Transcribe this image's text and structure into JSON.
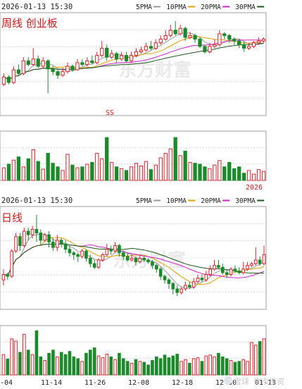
{
  "colors": {
    "up": "#e0202a",
    "down": "#1a8a2a",
    "ma5": "#9a9a9a",
    "ma10": "#e0a000",
    "ma20": "#d020d0",
    "ma30": "#1a5a1a",
    "grid": "#c8c8c8",
    "axis": "#888888",
    "text": "#222222",
    "chart_title": "#d01818",
    "watermark": "#e6e6e6"
  },
  "weekly": {
    "datetime": "2026-01-13 15:30",
    "legend": [
      {
        "label": "5PMA",
        "color_key": "ma5"
      },
      {
        "label": "10PMA",
        "color_key": "ma10"
      },
      {
        "label": "20PMA",
        "color_key": "ma20"
      },
      {
        "label": "30PMA",
        "color_key": "ma30"
      }
    ],
    "title": "周线 创业板",
    "marker": "SS",
    "year_label": "2026"
  },
  "daily": {
    "datetime": "2026-01-13 15:30",
    "legend": [
      {
        "label": "5PMA",
        "color_key": "ma5"
      },
      {
        "label": "10PMA",
        "color_key": "ma10"
      },
      {
        "label": "20PMA",
        "color_key": "ma20"
      },
      {
        "label": "30PMA",
        "color_key": "ma30"
      }
    ],
    "title": "日线",
    "date_labels": [
      "-04",
      "11-14",
      "11-26",
      "12-08",
      "12-18",
      "12-30",
      "01-13"
    ]
  },
  "watermark": {
    "top": "东方财富",
    "bottom_left": "雪球",
    "bottom_right": "牛市投资"
  },
  "chart_data": [
    {
      "type": "candlestick",
      "title": "周线 创业板",
      "period": "weekly",
      "price_range": [
        0,
        100
      ],
      "volume_range": [
        0,
        100
      ],
      "candles": [
        {
          "o": 30,
          "c": 38,
          "h": 42,
          "l": 28,
          "v": 28
        },
        {
          "o": 38,
          "c": 32,
          "h": 40,
          "l": 30,
          "v": 36
        },
        {
          "o": 32,
          "c": 46,
          "h": 50,
          "l": 30,
          "v": 45
        },
        {
          "o": 46,
          "c": 42,
          "h": 52,
          "l": 40,
          "v": 52
        },
        {
          "o": 42,
          "c": 56,
          "h": 60,
          "l": 40,
          "v": 30
        },
        {
          "o": 56,
          "c": 52,
          "h": 60,
          "l": 50,
          "v": 48
        },
        {
          "o": 52,
          "c": 58,
          "h": 70,
          "l": 50,
          "v": 68
        },
        {
          "o": 58,
          "c": 50,
          "h": 62,
          "l": 48,
          "v": 42
        },
        {
          "o": 50,
          "c": 56,
          "h": 60,
          "l": 48,
          "v": 25
        },
        {
          "o": 56,
          "c": 47,
          "h": 58,
          "l": 20,
          "v": 60
        },
        {
          "o": 47,
          "c": 44,
          "h": 50,
          "l": 40,
          "v": 38
        },
        {
          "o": 44,
          "c": 40,
          "h": 46,
          "l": 36,
          "v": 30
        },
        {
          "o": 40,
          "c": 44,
          "h": 48,
          "l": 38,
          "v": 22
        },
        {
          "o": 44,
          "c": 50,
          "h": 54,
          "l": 42,
          "v": 58
        },
        {
          "o": 50,
          "c": 46,
          "h": 52,
          "l": 44,
          "v": 34
        },
        {
          "o": 46,
          "c": 54,
          "h": 58,
          "l": 45,
          "v": 28
        },
        {
          "o": 54,
          "c": 52,
          "h": 58,
          "l": 50,
          "v": 30
        },
        {
          "o": 52,
          "c": 56,
          "h": 60,
          "l": 50,
          "v": 36
        },
        {
          "o": 56,
          "c": 54,
          "h": 62,
          "l": 52,
          "v": 40
        },
        {
          "o": 54,
          "c": 62,
          "h": 66,
          "l": 52,
          "v": 60
        },
        {
          "o": 62,
          "c": 70,
          "h": 78,
          "l": 60,
          "v": 48
        },
        {
          "o": 70,
          "c": 60,
          "h": 74,
          "l": 56,
          "v": 95
        },
        {
          "o": 60,
          "c": 64,
          "h": 68,
          "l": 58,
          "v": 40
        },
        {
          "o": 64,
          "c": 58,
          "h": 66,
          "l": 54,
          "v": 30
        },
        {
          "o": 58,
          "c": 62,
          "h": 66,
          "l": 56,
          "v": 26
        },
        {
          "o": 62,
          "c": 56,
          "h": 66,
          "l": 54,
          "v": 22
        },
        {
          "o": 56,
          "c": 62,
          "h": 66,
          "l": 54,
          "v": 30
        },
        {
          "o": 62,
          "c": 66,
          "h": 70,
          "l": 60,
          "v": 38
        },
        {
          "o": 66,
          "c": 68,
          "h": 72,
          "l": 64,
          "v": 32
        },
        {
          "o": 68,
          "c": 72,
          "h": 76,
          "l": 66,
          "v": 42
        },
        {
          "o": 72,
          "c": 70,
          "h": 78,
          "l": 68,
          "v": 24
        },
        {
          "o": 70,
          "c": 76,
          "h": 80,
          "l": 68,
          "v": 34
        },
        {
          "o": 76,
          "c": 80,
          "h": 84,
          "l": 74,
          "v": 50
        },
        {
          "o": 80,
          "c": 84,
          "h": 90,
          "l": 78,
          "v": 60
        },
        {
          "o": 84,
          "c": 90,
          "h": 96,
          "l": 82,
          "v": 70
        },
        {
          "o": 90,
          "c": 86,
          "h": 100,
          "l": 84,
          "v": 95
        },
        {
          "o": 86,
          "c": 92,
          "h": 96,
          "l": 84,
          "v": 55
        },
        {
          "o": 92,
          "c": 82,
          "h": 94,
          "l": 78,
          "v": 65
        },
        {
          "o": 82,
          "c": 84,
          "h": 88,
          "l": 80,
          "v": 40
        },
        {
          "o": 84,
          "c": 80,
          "h": 86,
          "l": 76,
          "v": 38
        },
        {
          "o": 80,
          "c": 72,
          "h": 82,
          "l": 70,
          "v": 36
        },
        {
          "o": 72,
          "c": 66,
          "h": 74,
          "l": 64,
          "v": 30
        },
        {
          "o": 66,
          "c": 72,
          "h": 76,
          "l": 64,
          "v": 26
        },
        {
          "o": 72,
          "c": 74,
          "h": 80,
          "l": 70,
          "v": 34
        },
        {
          "o": 74,
          "c": 86,
          "h": 90,
          "l": 72,
          "v": 44
        },
        {
          "o": 86,
          "c": 84,
          "h": 88,
          "l": 80,
          "v": 30
        },
        {
          "o": 84,
          "c": 80,
          "h": 86,
          "l": 76,
          "v": 40
        },
        {
          "o": 80,
          "c": 78,
          "h": 82,
          "l": 74,
          "v": 26
        },
        {
          "o": 78,
          "c": 74,
          "h": 80,
          "l": 70,
          "v": 30
        },
        {
          "o": 74,
          "c": 70,
          "h": 78,
          "l": 66,
          "v": 16
        },
        {
          "o": 70,
          "c": 72,
          "h": 76,
          "l": 68,
          "v": 22
        },
        {
          "o": 72,
          "c": 76,
          "h": 78,
          "l": 70,
          "v": 14
        },
        {
          "o": 76,
          "c": 78,
          "h": 82,
          "l": 74,
          "v": 24
        },
        {
          "o": 78,
          "c": 80,
          "h": 82,
          "l": 76,
          "v": 20
        }
      ]
    },
    {
      "type": "candlestick",
      "title": "日线",
      "period": "daily",
      "x_tick_labels": [
        "-04",
        "11-14",
        "11-26",
        "12-08",
        "12-18",
        "12-30",
        "01-13"
      ],
      "price_range": [
        0,
        100
      ],
      "volume_range": [
        0,
        100
      ],
      "candles": [
        {
          "o": 28,
          "c": 34,
          "h": 40,
          "l": 22,
          "v": 45
        },
        {
          "o": 34,
          "c": 32,
          "h": 36,
          "l": 28,
          "v": 35
        },
        {
          "o": 32,
          "c": 60,
          "h": 62,
          "l": 30,
          "v": 80
        },
        {
          "o": 60,
          "c": 76,
          "h": 80,
          "l": 58,
          "v": 75
        },
        {
          "o": 76,
          "c": 66,
          "h": 80,
          "l": 60,
          "v": 50
        },
        {
          "o": 66,
          "c": 82,
          "h": 86,
          "l": 64,
          "v": 90
        },
        {
          "o": 82,
          "c": 78,
          "h": 86,
          "l": 72,
          "v": 55
        },
        {
          "o": 78,
          "c": 84,
          "h": 88,
          "l": 74,
          "v": 45
        },
        {
          "o": 84,
          "c": 80,
          "h": 100,
          "l": 70,
          "v": 98
        },
        {
          "o": 80,
          "c": 72,
          "h": 84,
          "l": 66,
          "v": 40
        },
        {
          "o": 72,
          "c": 78,
          "h": 80,
          "l": 70,
          "v": 32
        },
        {
          "o": 78,
          "c": 70,
          "h": 82,
          "l": 64,
          "v": 48
        },
        {
          "o": 70,
          "c": 64,
          "h": 74,
          "l": 60,
          "v": 55
        },
        {
          "o": 64,
          "c": 72,
          "h": 78,
          "l": 60,
          "v": 40
        },
        {
          "o": 72,
          "c": 68,
          "h": 74,
          "l": 64,
          "v": 50
        },
        {
          "o": 68,
          "c": 62,
          "h": 72,
          "l": 58,
          "v": 45
        },
        {
          "o": 62,
          "c": 58,
          "h": 66,
          "l": 54,
          "v": 52
        },
        {
          "o": 58,
          "c": 56,
          "h": 60,
          "l": 50,
          "v": 40
        },
        {
          "o": 56,
          "c": 54,
          "h": 58,
          "l": 48,
          "v": 36
        },
        {
          "o": 54,
          "c": 60,
          "h": 62,
          "l": 52,
          "v": 30
        },
        {
          "o": 60,
          "c": 52,
          "h": 62,
          "l": 48,
          "v": 48
        },
        {
          "o": 52,
          "c": 46,
          "h": 56,
          "l": 42,
          "v": 55
        },
        {
          "o": 46,
          "c": 42,
          "h": 50,
          "l": 40,
          "v": 60
        },
        {
          "o": 42,
          "c": 50,
          "h": 52,
          "l": 40,
          "v": 42
        },
        {
          "o": 50,
          "c": 56,
          "h": 58,
          "l": 48,
          "v": 38
        },
        {
          "o": 56,
          "c": 62,
          "h": 68,
          "l": 54,
          "v": 46
        },
        {
          "o": 62,
          "c": 60,
          "h": 66,
          "l": 56,
          "v": 40
        },
        {
          "o": 60,
          "c": 66,
          "h": 70,
          "l": 58,
          "v": 34
        },
        {
          "o": 66,
          "c": 58,
          "h": 68,
          "l": 54,
          "v": 48
        },
        {
          "o": 58,
          "c": 54,
          "h": 60,
          "l": 50,
          "v": 36
        },
        {
          "o": 54,
          "c": 50,
          "h": 58,
          "l": 48,
          "v": 30
        },
        {
          "o": 50,
          "c": 52,
          "h": 56,
          "l": 48,
          "v": 26
        },
        {
          "o": 52,
          "c": 48,
          "h": 54,
          "l": 44,
          "v": 34
        },
        {
          "o": 48,
          "c": 52,
          "h": 56,
          "l": 46,
          "v": 30
        },
        {
          "o": 52,
          "c": 50,
          "h": 54,
          "l": 48,
          "v": 28
        },
        {
          "o": 50,
          "c": 48,
          "h": 52,
          "l": 46,
          "v": 22
        },
        {
          "o": 48,
          "c": 44,
          "h": 50,
          "l": 40,
          "v": 32
        },
        {
          "o": 44,
          "c": 40,
          "h": 46,
          "l": 36,
          "v": 40
        },
        {
          "o": 40,
          "c": 32,
          "h": 42,
          "l": 28,
          "v": 36
        },
        {
          "o": 32,
          "c": 28,
          "h": 34,
          "l": 24,
          "v": 44
        },
        {
          "o": 28,
          "c": 24,
          "h": 30,
          "l": 18,
          "v": 38
        },
        {
          "o": 24,
          "c": 18,
          "h": 26,
          "l": 12,
          "v": 42
        },
        {
          "o": 18,
          "c": 14,
          "h": 22,
          "l": 10,
          "v": 46
        },
        {
          "o": 14,
          "c": 18,
          "h": 20,
          "l": 12,
          "v": 30
        },
        {
          "o": 18,
          "c": 22,
          "h": 26,
          "l": 16,
          "v": 34
        },
        {
          "o": 22,
          "c": 20,
          "h": 26,
          "l": 18,
          "v": 26
        },
        {
          "o": 20,
          "c": 26,
          "h": 30,
          "l": 18,
          "v": 36
        },
        {
          "o": 26,
          "c": 30,
          "h": 34,
          "l": 24,
          "v": 38
        },
        {
          "o": 30,
          "c": 28,
          "h": 34,
          "l": 26,
          "v": 30
        },
        {
          "o": 28,
          "c": 34,
          "h": 38,
          "l": 26,
          "v": 42
        },
        {
          "o": 34,
          "c": 40,
          "h": 44,
          "l": 32,
          "v": 44
        },
        {
          "o": 40,
          "c": 44,
          "h": 50,
          "l": 38,
          "v": 40
        },
        {
          "o": 44,
          "c": 42,
          "h": 50,
          "l": 40,
          "v": 48
        },
        {
          "o": 42,
          "c": 36,
          "h": 46,
          "l": 34,
          "v": 40
        },
        {
          "o": 36,
          "c": 34,
          "h": 40,
          "l": 30,
          "v": 36
        },
        {
          "o": 34,
          "c": 40,
          "h": 42,
          "l": 32,
          "v": 32
        },
        {
          "o": 40,
          "c": 38,
          "h": 44,
          "l": 36,
          "v": 28
        },
        {
          "o": 38,
          "c": 36,
          "h": 42,
          "l": 34,
          "v": 30
        },
        {
          "o": 36,
          "c": 40,
          "h": 48,
          "l": 34,
          "v": 34
        },
        {
          "o": 40,
          "c": 44,
          "h": 48,
          "l": 38,
          "v": 30
        },
        {
          "o": 44,
          "c": 46,
          "h": 48,
          "l": 42,
          "v": 72
        },
        {
          "o": 46,
          "c": 50,
          "h": 64,
          "l": 44,
          "v": 66
        },
        {
          "o": 50,
          "c": 46,
          "h": 54,
          "l": 44,
          "v": 74
        },
        {
          "o": 46,
          "c": 56,
          "h": 66,
          "l": 44,
          "v": 80
        }
      ]
    }
  ]
}
